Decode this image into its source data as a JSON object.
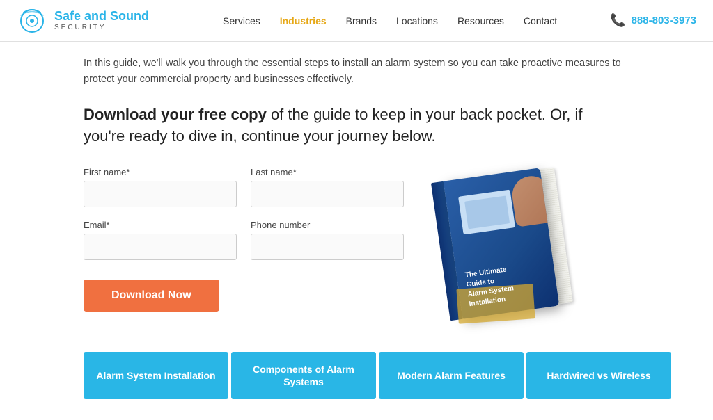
{
  "header": {
    "logo_main": "Safe and Sound",
    "logo_sub": "SECURITY",
    "nav_items": [
      {
        "label": "Services",
        "active": false
      },
      {
        "label": "Industries",
        "active": true
      },
      {
        "label": "Brands",
        "active": false
      },
      {
        "label": "Locations",
        "active": false
      },
      {
        "label": "Resources",
        "active": false
      },
      {
        "label": "Contact",
        "active": false
      }
    ],
    "phone": "888-803-3973"
  },
  "main": {
    "intro_text": "In this guide, we'll walk you through the essential steps to install an alarm system so you can take proactive measures to protect your commercial property and businesses effectively.",
    "headline_bold": "Download your free copy",
    "headline_rest": " of the guide to keep in your back pocket. Or, if you're ready to dive in, continue your journey below.",
    "form": {
      "first_name_label": "First name*",
      "last_name_label": "Last name*",
      "email_label": "Email*",
      "phone_label": "Phone number",
      "first_name_placeholder": "",
      "last_name_placeholder": "",
      "email_placeholder": "",
      "phone_placeholder": "",
      "download_button": "Download Now"
    },
    "book": {
      "title_line1": "The Ultimate",
      "title_line2": "Guide to",
      "title_line3": "Alarm System",
      "title_line4": "Installation"
    },
    "tabs": [
      {
        "label": "Alarm System\nInstallation"
      },
      {
        "label": "Components of Alarm\nSystems"
      },
      {
        "label": "Modern Alarm\nFeatures"
      },
      {
        "label": "Hardwired vs Wireless"
      }
    ]
  }
}
